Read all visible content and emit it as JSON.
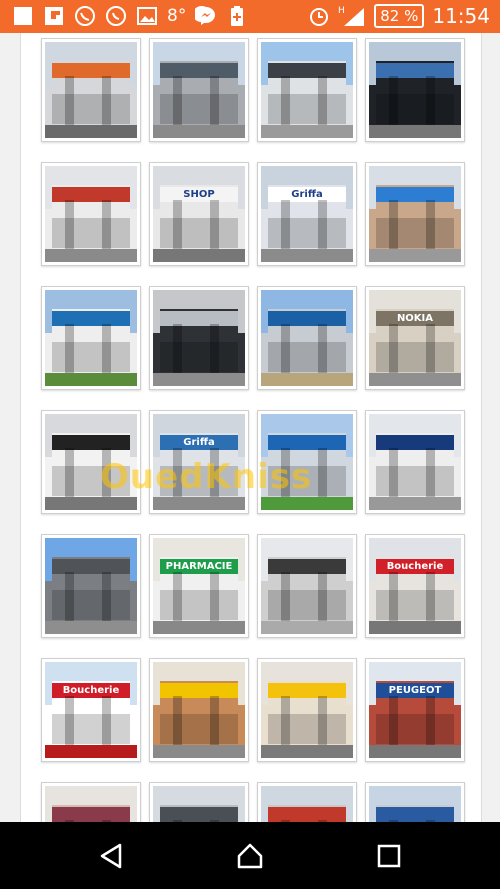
{
  "status_bar": {
    "notifications_text": "8°",
    "battery": "82 %",
    "time": "11:54",
    "network": "H",
    "icons": [
      "image-icon",
      "flipboard-icon",
      "viber-icon",
      "whatsapp-icon",
      "gallery-icon",
      "messenger-icon",
      "battery-plus-icon"
    ]
  },
  "watermark": "OuedKniss",
  "gallery": {
    "images": [
      {
        "label": "",
        "sky": "#cfd8e0",
        "wall": "#d5d7da",
        "accent": "#e06a2b",
        "ground": "#6a6a6a"
      },
      {
        "label": "",
        "sky": "#c8d6e6",
        "wall": "#a9adb2",
        "accent": "#4f5b66",
        "ground": "#8a8a8a"
      },
      {
        "label": "",
        "sky": "#9fc4ea",
        "wall": "#dfe2e5",
        "accent": "#3b3f46",
        "ground": "#9a9a9a"
      },
      {
        "label": "",
        "sky": "#b8c8d8",
        "wall": "#1f2328",
        "accent": "#3a6fb0",
        "ground": "#777"
      },
      {
        "label": "",
        "sky": "#e2e4e7",
        "wall": "#ececec",
        "accent": "#c0392b",
        "ground": "#8a8a8a"
      },
      {
        "label": "SHOP",
        "sky": "#d9dde2",
        "wall": "#e8e8e8",
        "accent": "#f4f4f4",
        "ground": "#777"
      },
      {
        "label": "Griffa",
        "sky": "#c9d3dd",
        "wall": "#e0e4ea",
        "accent": "#ffffff",
        "ground": "#8b8b8b"
      },
      {
        "label": "",
        "sky": "#d7dee6",
        "wall": "#c9a78a",
        "accent": "#2d7dd2",
        "ground": "#999"
      },
      {
        "label": "",
        "sky": "#9dbee0",
        "wall": "#eeeeee",
        "accent": "#1f6fb5",
        "ground": "#5b8c3a"
      },
      {
        "label": "",
        "sky": "#c5c7cb",
        "wall": "#2e3135",
        "accent": "#b8bdc3",
        "ground": "#8d8d8d"
      },
      {
        "label": "",
        "sky": "#8eb7e3",
        "wall": "#c7ccd2",
        "accent": "#1b5fa5",
        "ground": "#b9a57c"
      },
      {
        "label": "NOKIA",
        "sky": "#e4e1da",
        "wall": "#d8d0c2",
        "accent": "#7d7466",
        "ground": "#8f8f8f"
      },
      {
        "label": "",
        "sky": "#d7d9dc",
        "wall": "#f2f2f2",
        "accent": "#222222",
        "ground": "#777"
      },
      {
        "label": "Griffa",
        "sky": "#cfd6de",
        "wall": "#dfe3e8",
        "accent": "#2d6fb3",
        "ground": "#8a8a8a"
      },
      {
        "label": "",
        "sky": "#a9c8ea",
        "wall": "#d0d7df",
        "accent": "#1d66b3",
        "ground": "#4f9a3a"
      },
      {
        "label": "",
        "sky": "#e3e6ea",
        "wall": "#eeeeee",
        "accent": "#163a7a",
        "ground": "#999"
      },
      {
        "label": "",
        "sky": "#6ea6e6",
        "wall": "#7b7f84",
        "accent": "#505458",
        "ground": "#8e8e8e"
      },
      {
        "label": "PHARMACIE",
        "sky": "#e9e6e0",
        "wall": "#f0f0f0",
        "accent": "#1e9e4a",
        "ground": "#888"
      },
      {
        "label": "",
        "sky": "#e6e8eb",
        "wall": "#cfcfcf",
        "accent": "#3a3a3a",
        "ground": "#aaa"
      },
      {
        "label": "Boucherie",
        "sky": "#dfe3e7",
        "wall": "#e7e4e0",
        "accent": "#d0202a",
        "ground": "#777"
      },
      {
        "label": "Boucherie",
        "sky": "#cfe0f0",
        "wall": "#ffffff",
        "accent": "#cf1d2a",
        "ground": "#b71c1c"
      },
      {
        "label": "",
        "sky": "#e8e2d6",
        "wall": "#c98a5a",
        "accent": "#f2c400",
        "ground": "#8a8a8a"
      },
      {
        "label": "",
        "sky": "#e7e3dc",
        "wall": "#e9dfcf",
        "accent": "#f4c20d",
        "ground": "#7a7a7a"
      },
      {
        "label": "PEUGEOT",
        "sky": "#dfe6ee",
        "wall": "#b64a3b",
        "accent": "#1f4f99",
        "ground": "#777"
      },
      {
        "label": "",
        "sky": "#e7e4e0",
        "wall": "#d8b9b0",
        "accent": "#8a3a4a",
        "ground": "#999"
      },
      {
        "label": "",
        "sky": "#d6dbe2",
        "wall": "#b9bec5",
        "accent": "#4a4f56",
        "ground": "#888"
      },
      {
        "label": "",
        "sky": "#cfd7e0",
        "wall": "#c8c8c8",
        "accent": "#c0392b",
        "ground": "#888"
      },
      {
        "label": "",
        "sky": "#c6d4e4",
        "wall": "#c7ccd2",
        "accent": "#2a5aa0",
        "ground": "#888"
      }
    ]
  },
  "nav": {
    "back": "back-icon",
    "home": "home-icon",
    "recent": "recents-icon"
  }
}
